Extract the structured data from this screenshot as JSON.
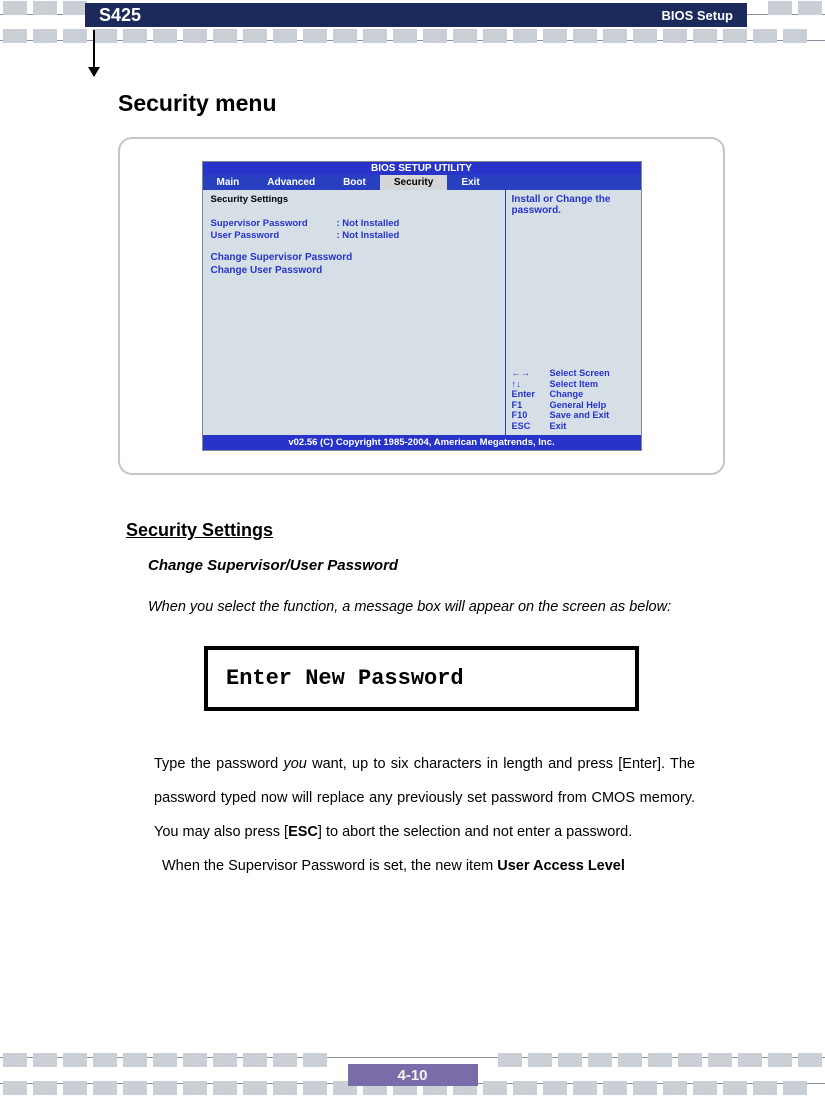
{
  "header": {
    "model": "S425",
    "section": "BIOS Setup"
  },
  "page_title": "Security menu",
  "bios": {
    "title": "BIOS SETUP UTILITY",
    "tabs": [
      "Main",
      "Advanced",
      "Boot",
      "Security",
      "Exit"
    ],
    "active_tab": "Security",
    "left": {
      "section": "Security Settings",
      "rows": [
        {
          "label": "Supervisor Password",
          "value": ": Not Installed"
        },
        {
          "label": "User Password",
          "value": ": Not Installed"
        }
      ],
      "links": [
        "Change Supervisor Password",
        "Change User Password"
      ]
    },
    "right": {
      "help_top": "Install or Change the password.",
      "help_nav": [
        {
          "key": "←→",
          "action": "Select Screen"
        },
        {
          "key": "↑↓",
          "action": "Select Item"
        },
        {
          "key": "Enter",
          "action": "Change"
        },
        {
          "key": "F1",
          "action": "General Help"
        },
        {
          "key": "F10",
          "action": "Save and Exit"
        },
        {
          "key": "ESC",
          "action": "Exit"
        }
      ]
    },
    "footer": "v02.56 (C) Copyright  1985-2004, American Megatrends, Inc."
  },
  "sections": {
    "security_settings": "Security Settings",
    "change_pwd_heading": "Change Supervisor/User Password",
    "intro": "When you select the function, a message box will appear on the screen as below:",
    "password_box": "Enter New Password",
    "para1_a": "Type the password ",
    "para1_you": "you",
    "para1_b": " want, up to six characters in length and press [Enter].  The password typed now will replace any previously set password from CMOS memory. You may also press [",
    "para1_esc": "ESC",
    "para1_c": "] to abort the selection and not enter a password.",
    "para2_a": "When the Supervisor Password is set, the new item ",
    "para2_ual": "User Access Level"
  },
  "page_number": "4-10"
}
